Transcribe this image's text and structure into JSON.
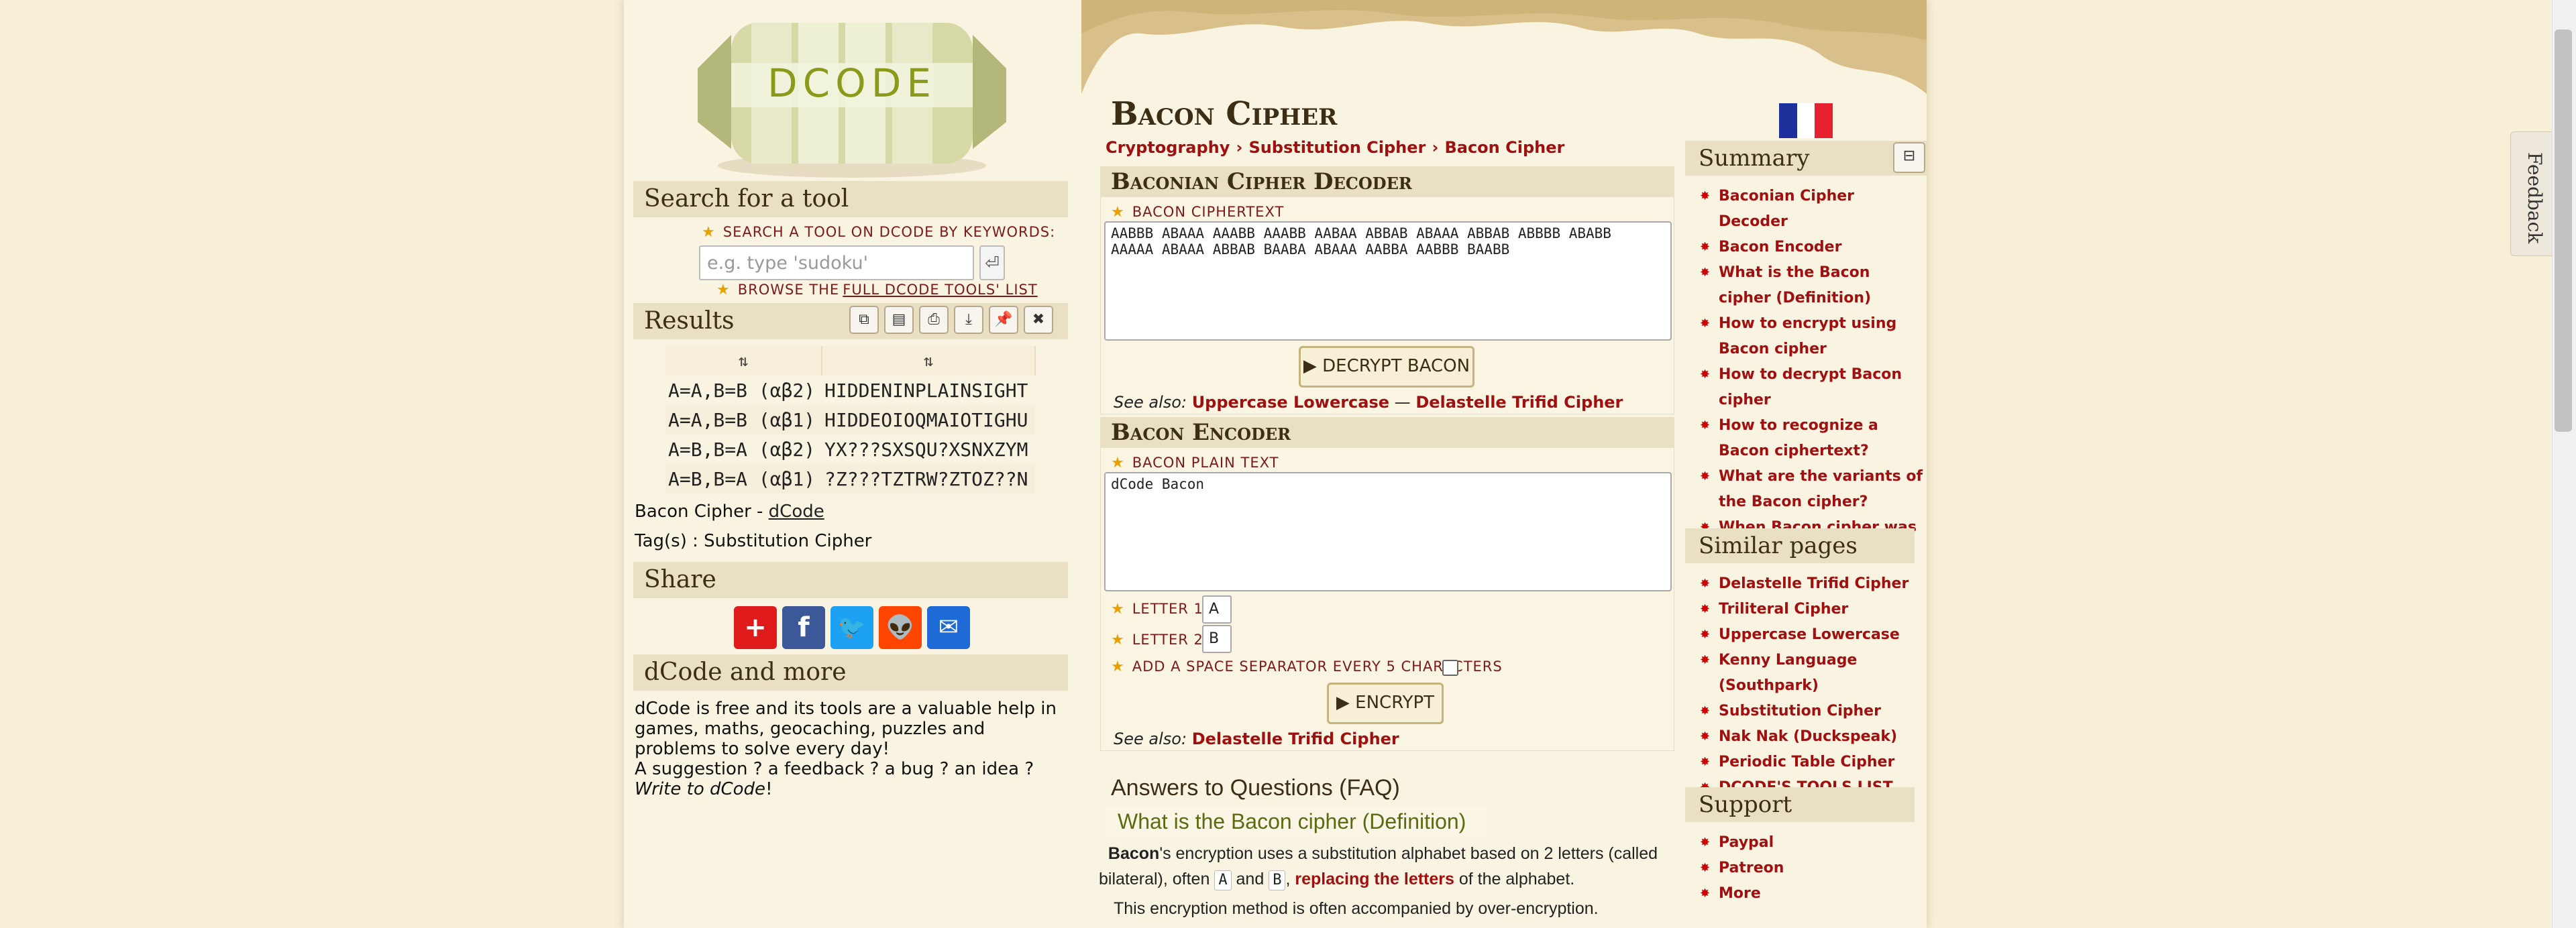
{
  "left": {
    "search": {
      "heading": "Search for a tool",
      "keywords_label": "SEARCH A TOOL ON DCODE BY KEYWORDS:",
      "placeholder": "e.g. type 'sudoku'",
      "browse_prefix": "BROWSE THE",
      "browse_link": "FULL DCODE TOOLS' LIST"
    },
    "results": {
      "heading": "Results",
      "sort_header_1": "⇅",
      "sort_header_2": "⇅",
      "rows": [
        {
          "key": "A=A,B=B (αβ2)",
          "value": "HIDDENINPLAINSIGHT"
        },
        {
          "key": "A=A,B=B (αβ1)",
          "value": "HIDDEOIOQMAIOTIGHU"
        },
        {
          "key": "A=B,B=A (αβ2)",
          "value": "YX???SXSQU?XSNXZYM"
        },
        {
          "key": "A=B,B=A (αβ1)",
          "value": "?Z???TZTRW?ZTOZ??N"
        }
      ],
      "footer_prefix": "Bacon Cipher - ",
      "footer_link": "dCode",
      "tags": "Tag(s) : Substitution Cipher"
    },
    "share": {
      "heading": "Share"
    },
    "more": {
      "heading": "dCode and more",
      "paragraph": "dCode is free and its tools are a valuable help in games, maths, geocaching, puzzles and problems to solve every day!",
      "suggestion": "A suggestion ? a feedback ? a bug ? an idea ? ",
      "write_link": "Write to dCode",
      "end": "!"
    }
  },
  "main": {
    "title": "Bacon Cipher",
    "breadcrumb": [
      "Cryptography",
      "Substitution Cipher",
      "Bacon Cipher"
    ],
    "decoder": {
      "heading": "Baconian Cipher Decoder",
      "field_label": "BACON CIPHERTEXT",
      "ciphertext": "AABBB ABAAA AAABB AAABB AABAA ABBAB ABAAA ABBAB ABBBB ABABB\nAAAAA ABAAA ABBAB BAABA ABAAA AABBA AABBB BAABB",
      "button": "▶ DECRYPT BACON",
      "see_also_label": "See also:",
      "see_also_1": "Uppercase Lowercase",
      "see_also_sep": " — ",
      "see_also_2": "Delastelle Trifid Cipher"
    },
    "encoder": {
      "heading": "Bacon Encoder",
      "field_label": "BACON PLAIN TEXT",
      "plaintext": "dCode Bacon",
      "letter1_label": "LETTER 1",
      "letter1_value": "A",
      "letter2_label": "LETTER 2",
      "letter2_value": "B",
      "separator_label": "ADD A SPACE SEPARATOR EVERY 5 CHARACTERS",
      "button": "▶ ENCRYPT",
      "see_also_label": "See also:",
      "see_also_1": "Delastelle Trifid Cipher"
    },
    "faq": {
      "heading": "Answers to Questions (FAQ)",
      "question": "What is the Bacon cipher (Definition)",
      "p1_bold": "Bacon",
      "p1_a": "'s encryption uses a substitution alphabet based on 2 letters (called bilateral), often ",
      "p1_kbd1": "A",
      "p1_and": " and ",
      "p1_kbd2": "B",
      "p1_comma": ", ",
      "p1_link": "replacing the letters",
      "p1_end": " of the alphabet.",
      "p2": "This encryption method is often accompanied by over-encryption."
    }
  },
  "right": {
    "summary": {
      "heading": "Summary",
      "items": [
        "Baconian Cipher Decoder",
        "Bacon Encoder",
        "What is the Bacon cipher (Definition)",
        "How to encrypt using Bacon cipher",
        "How to decrypt Bacon cipher",
        "How to recognize a Bacon ciphertext?",
        "What are the variants of the Bacon cipher?",
        "When Bacon cipher was invented?"
      ]
    },
    "similar": {
      "heading": "Similar pages",
      "items": [
        "Delastelle Trifid Cipher",
        "Triliteral Cipher",
        "Uppercase Lowercase",
        "Kenny Language (Southpark)",
        "Substitution Cipher",
        "Nak Nak (Duckspeak)",
        "Periodic Table Cipher",
        "DCODE'S TOOLS LIST"
      ]
    },
    "support": {
      "heading": "Support",
      "items": [
        "Paypal",
        "Patreon",
        "More"
      ]
    },
    "feedback": "Feedback",
    "logo_text": "DCODE"
  }
}
